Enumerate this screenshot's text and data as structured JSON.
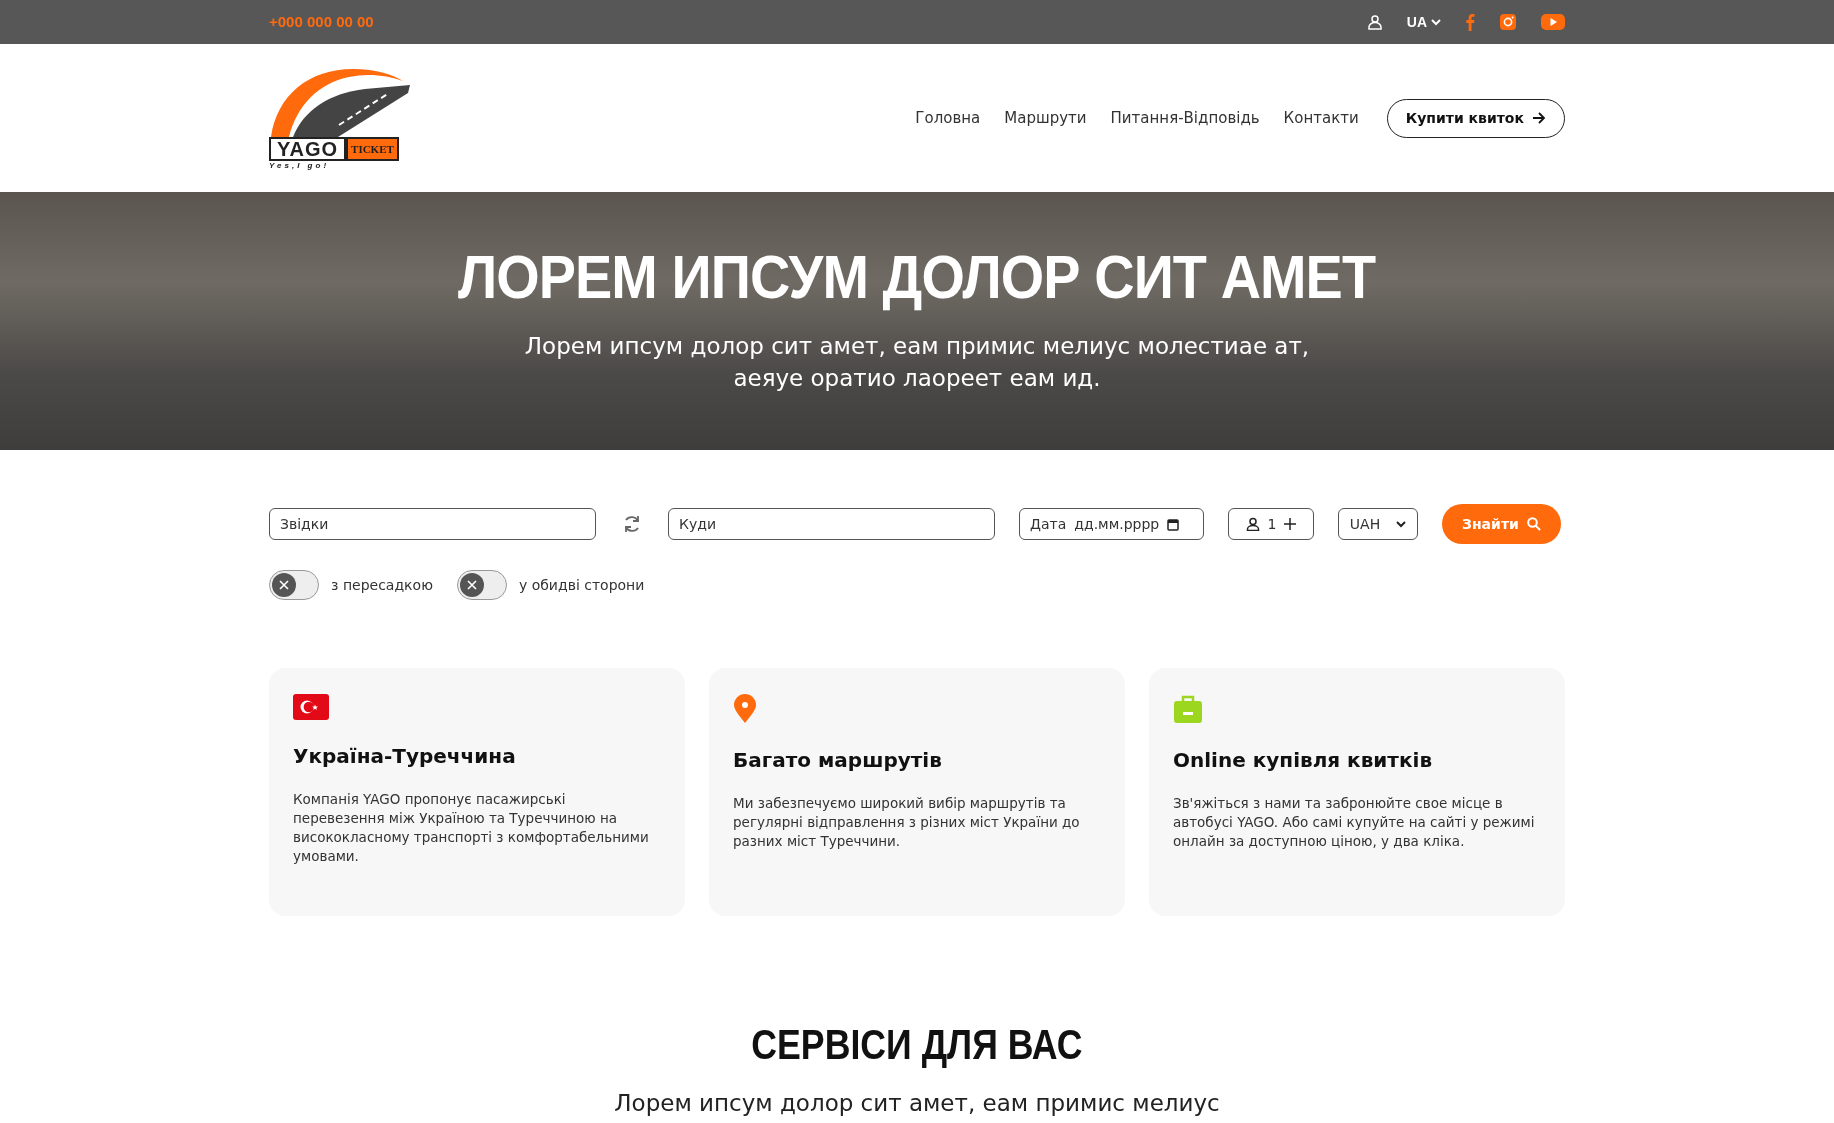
{
  "topbar": {
    "phone": "+000 000 00 00",
    "language": "UA"
  },
  "logo": {
    "word": "YAGO",
    "badge": "TICKET",
    "slogan": "Yes,I go!"
  },
  "nav": {
    "links": [
      {
        "label": "Головна"
      },
      {
        "label": "Маршрути"
      },
      {
        "label": "Питання-Відповідь"
      },
      {
        "label": "Контакти"
      }
    ],
    "cta": "Купити квиток"
  },
  "hero": {
    "title": "ЛОРЕМ ИПСУМ ДОЛОР СИТ АМЕТ",
    "subtitle": "Лорем ипсум долор сит амет, еам примис мелиус молестиае ат, аеяуе оратио лаореет еам ид."
  },
  "search": {
    "from": {
      "placeholder": "Звідки"
    },
    "to": {
      "placeholder": "Куди"
    },
    "date": {
      "label": "Дата",
      "placeholder": "дд.мм.рррр"
    },
    "passengers": "1",
    "currency": "UAH",
    "submit": "Знайти",
    "toggles": [
      {
        "label": "з пересадкою",
        "on": false
      },
      {
        "label": "у обидві сторони",
        "on": false
      }
    ]
  },
  "features": [
    {
      "kind": "flag",
      "title": "Україна-Туреччина",
      "text": "Компанія YAGO пропонує пасажирські перевезення між Україною та Туреччиною на висококласному транспорті з комфортабельними умовами."
    },
    {
      "kind": "pin",
      "title": "Багато маршрутів",
      "text": "Ми забезпечуємо широкий вибір маршрутів та регулярні відправлення з різних міст України до разних міст Туреччини."
    },
    {
      "kind": "bag",
      "title": "Online купівля квитків",
      "text": "Зв'яжіться з нами та забронюйте свое місце в автобусі YAGO. Або самі купуйте на сайті у режимі онлайн за доступною ціною, у два кліка."
    }
  ],
  "services": {
    "title": "СЕРВІСИ ДЛЯ ВАС",
    "subtitle": "Лорем ипсум долор сит амет, еам примис мелиус"
  }
}
